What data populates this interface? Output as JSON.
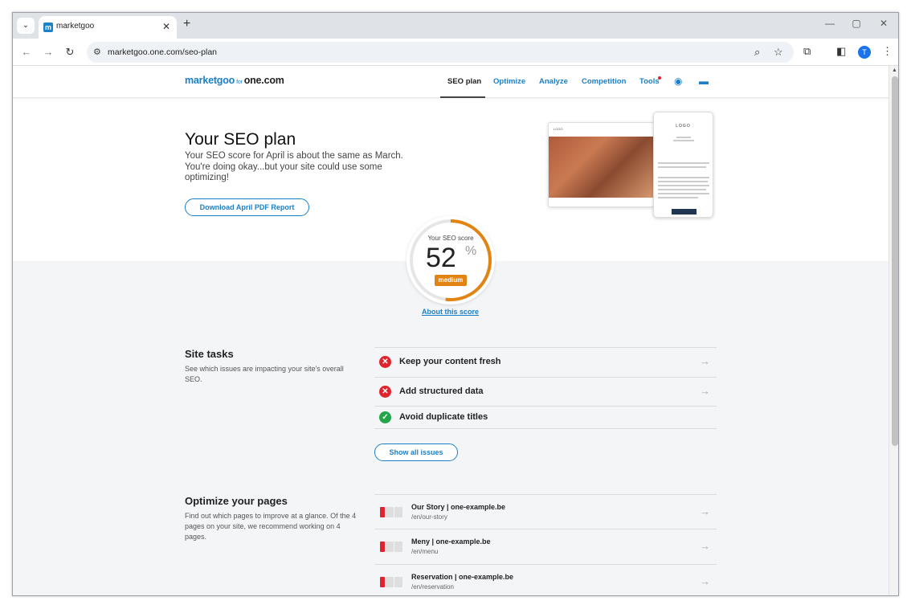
{
  "browser": {
    "tab_title": "marketgoo",
    "tab_close": "✕",
    "new_tab": "+",
    "url": "marketgoo.one.com/seo-plan",
    "profile_initial": "T"
  },
  "header": {
    "logo_main": "marketgoo",
    "logo_for": "for",
    "logo_partner": "one.com",
    "nav": [
      "SEO plan",
      "Optimize",
      "Analyze",
      "Competition",
      "Tools"
    ],
    "active_nav": "SEO plan"
  },
  "hero": {
    "title": "Your SEO plan",
    "subtitle": "Your SEO score for April is about the same as March. You're doing okay...but your site could use some optimizing!",
    "download_button": "Download April PDF Report"
  },
  "score": {
    "label": "Your SEO score",
    "value": "52",
    "unit": "%",
    "percent": 52,
    "rating": "medium",
    "about_link": "About this score",
    "accent_color": "#e18412"
  },
  "site_tasks": {
    "title": "Site tasks",
    "description": "See which issues are impacting your site's overall SEO.",
    "items": [
      {
        "label": "Keep your content fresh",
        "status": "fail"
      },
      {
        "label": "Add structured data",
        "status": "fail"
      },
      {
        "label": "Avoid duplicate titles",
        "status": "pass"
      }
    ],
    "show_all_button": "Show all issues"
  },
  "optimize_pages": {
    "title": "Optimize your pages",
    "description": "Find out which pages to improve at a glance. Of the 4 pages on your site, we recommend working on 4 pages.",
    "items": [
      {
        "title": "Our Story | one-example.be",
        "path": "/en/our-story"
      },
      {
        "title": "Meny | one-example.be",
        "path": "/en/menu"
      },
      {
        "title": "Reservation | one-example.be",
        "path": "/en/reservation"
      }
    ]
  },
  "colors": {
    "brand": "#1b7fc7",
    "fail": "#e0242f",
    "pass": "#22a44a",
    "score": "#e18412"
  }
}
